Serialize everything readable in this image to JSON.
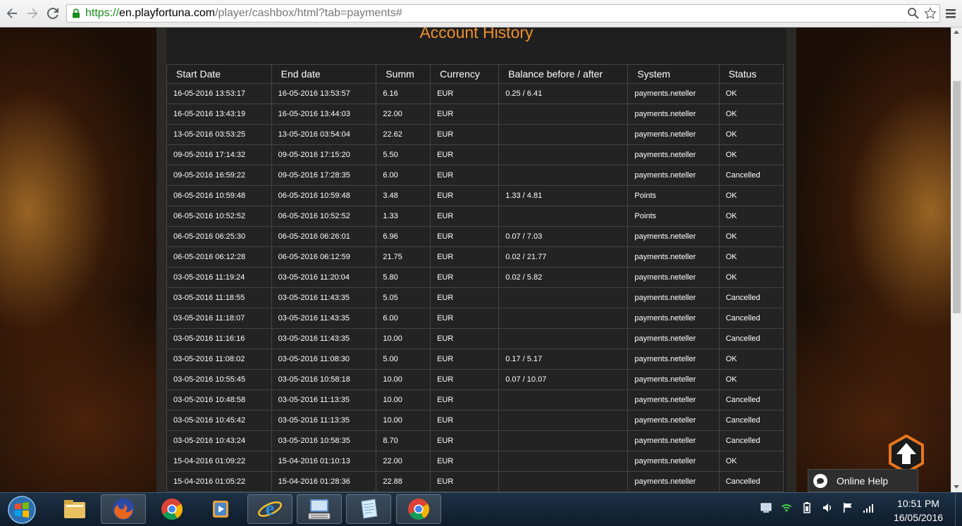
{
  "browser": {
    "url_scheme": "https://",
    "url_host": "en.playfortuna.com",
    "url_path": "/player/cashbox/html?tab=payments#"
  },
  "page": {
    "title": "Account History",
    "columns": [
      "Start Date",
      "End date",
      "Summ",
      "Currency",
      "Balance before / after",
      "System",
      "Status"
    ],
    "rows": [
      [
        "16-05-2016 13:53:17",
        "16-05-2016 13:53:57",
        "6.16",
        "EUR",
        "0.25 / 6.41",
        "payments.neteller",
        "OK"
      ],
      [
        "16-05-2016 13:43:19",
        "16-05-2016 13:44:03",
        "22.00",
        "EUR",
        "",
        "payments.neteller",
        "OK"
      ],
      [
        "13-05-2016 03:53:25",
        "13-05-2016 03:54:04",
        "22.62",
        "EUR",
        "",
        "payments.neteller",
        "OK"
      ],
      [
        "09-05-2016 17:14:32",
        "09-05-2016 17:15:20",
        "5.50",
        "EUR",
        "",
        "payments.neteller",
        "OK"
      ],
      [
        "09-05-2016 16:59:22",
        "09-05-2016 17:28:35",
        "6.00",
        "EUR",
        "",
        "payments.neteller",
        "Cancelled"
      ],
      [
        "06-05-2016 10:59:48",
        "06-05-2016 10:59:48",
        "3.48",
        "EUR",
        "1.33 / 4.81",
        "Points",
        "OK"
      ],
      [
        "06-05-2016 10:52:52",
        "06-05-2016 10:52:52",
        "1.33",
        "EUR",
        "",
        "Points",
        "OK"
      ],
      [
        "06-05-2016 06:25:30",
        "06-05-2016 06:26:01",
        "6.96",
        "EUR",
        "0.07 / 7.03",
        "payments.neteller",
        "OK"
      ],
      [
        "06-05-2016 06:12:28",
        "06-05-2016 06:12:59",
        "21.75",
        "EUR",
        "0.02 / 21.77",
        "payments.neteller",
        "OK"
      ],
      [
        "03-05-2016 11:19:24",
        "03-05-2016 11:20:04",
        "5.80",
        "EUR",
        "0.02 / 5.82",
        "payments.neteller",
        "OK"
      ],
      [
        "03-05-2016 11:18:55",
        "03-05-2016 11:43:35",
        "5.05",
        "EUR",
        "",
        "payments.neteller",
        "Cancelled"
      ],
      [
        "03-05-2016 11:18:07",
        "03-05-2016 11:43:35",
        "6.00",
        "EUR",
        "",
        "payments.neteller",
        "Cancelled"
      ],
      [
        "03-05-2016 11:16:16",
        "03-05-2016 11:43:35",
        "10.00",
        "EUR",
        "",
        "payments.neteller",
        "Cancelled"
      ],
      [
        "03-05-2016 11:08:02",
        "03-05-2016 11:08:30",
        "5.00",
        "EUR",
        "0.17 / 5.17",
        "payments.neteller",
        "OK"
      ],
      [
        "03-05-2016 10:55:45",
        "03-05-2016 10:58:18",
        "10.00",
        "EUR",
        "0.07 / 10.07",
        "payments.neteller",
        "OK"
      ],
      [
        "03-05-2016 10:48:58",
        "03-05-2016 11:13:35",
        "10.00",
        "EUR",
        "",
        "payments.neteller",
        "Cancelled"
      ],
      [
        "03-05-2016 10:45:42",
        "03-05-2016 11:13:35",
        "10.00",
        "EUR",
        "",
        "payments.neteller",
        "Cancelled"
      ],
      [
        "03-05-2016 10:43:24",
        "03-05-2016 10:58:35",
        "8.70",
        "EUR",
        "",
        "payments.neteller",
        "Cancelled"
      ],
      [
        "15-04-2016 01:09:22",
        "15-04-2016 01:10:13",
        "22.00",
        "EUR",
        "",
        "payments.neteller",
        "OK"
      ],
      [
        "15-04-2016 01:05:22",
        "15-04-2016 01:28:36",
        "22.88",
        "EUR",
        "",
        "payments.neteller",
        "Cancelled"
      ]
    ],
    "online_help_label": "Online Help",
    "accent_color": "#f0902a"
  },
  "taskbar": {
    "items": [
      "windows-explorer",
      "firefox",
      "chrome",
      "media-player",
      "internet-explorer",
      "on-screen-keyboard",
      "notepad",
      "chrome-active"
    ],
    "clock_time": "10:51 PM",
    "clock_date": "16/05/2016"
  }
}
